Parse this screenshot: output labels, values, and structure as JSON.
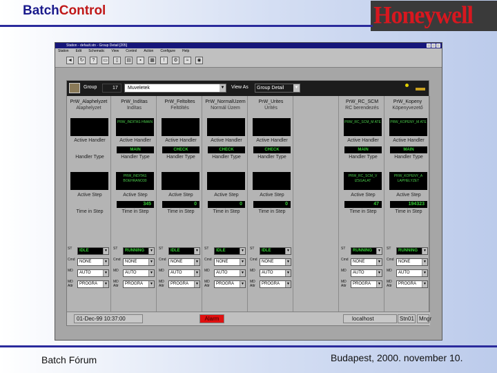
{
  "slide": {
    "title_part1": "Batch",
    "title_part2": "Control",
    "logo_text": "Honeywell",
    "footer_left": "Batch Fórum",
    "footer_right": "Budapest, 2000. november 10."
  },
  "window": {
    "titlebar": "Station - default.stn - Group Detail [205]",
    "menu": [
      "Station",
      "Edit",
      "Schematic",
      "View",
      "Control",
      "Action",
      "Configure",
      "Help"
    ]
  },
  "group_bar": {
    "group_label": "Group",
    "group_number": "17",
    "group_name": "Muveletek",
    "view_as_label": "View As",
    "view_as_value": "Group Detail"
  },
  "field_labels": {
    "active_handler": "Active Handler",
    "handler_type": "Handler Type",
    "active_step": "Active Step",
    "time_in_step": "Time in Step"
  },
  "columns": [
    {
      "tag": "PrW_Alaphelyzet",
      "desc": "Alaphelyzet",
      "handler_box": "",
      "handler_type": "",
      "step_box": "",
      "step": "",
      "state": "IDLE",
      "cmd": "NONE",
      "mode": "AUTO",
      "prog": "PROGRA"
    },
    {
      "tag": "PrW_Indítas",
      "desc": "Indítas",
      "handler_box": "PRW_INDITAS HMAIN",
      "handler_type": "MAIN",
      "step_box": "PRW_INDITAS BOEHRANO30",
      "step": "345",
      "state": "RUNNING",
      "cmd": "NONE",
      "mode": "AUTO",
      "prog": "PROGRA"
    },
    {
      "tag": "PrW_Feltoltes",
      "desc": "Feltöltés",
      "handler_box": "",
      "handler_type": "CHECK",
      "step_box": "",
      "step": "0",
      "state": "IDLE",
      "cmd": "NONE",
      "mode": "AUTO",
      "prog": "PROGRA"
    },
    {
      "tag": "PrW_NormalUzem",
      "desc": "Normál Üzem",
      "handler_box": "",
      "handler_type": "CHECK",
      "step_box": "",
      "step": "0",
      "state": "IDLE",
      "cmd": "NONE",
      "mode": "AUTO",
      "prog": "PROGRA"
    },
    {
      "tag": "PrW_Urites",
      "desc": "Ürítés",
      "handler_box": "",
      "handler_type": "CHECK",
      "step_box": "",
      "step": "0",
      "state": "IDLE",
      "cmd": "NONE",
      "mode": "AUTO",
      "prog": "PROGRA"
    },
    {
      "tag": "",
      "desc": "",
      "handler_box": "",
      "handler_type": "",
      "step_box": "",
      "step": "",
      "state": "",
      "cmd": "",
      "mode": "",
      "prog": ""
    },
    {
      "tag": "PrW_RC_SCM",
      "desc": "RC berendezés",
      "handler_box": "PRW_RC_SCM_M ATE",
      "handler_type": "MAIN",
      "step_box": "PRW_RC_SCM_V IZSGALAT",
      "step": "47",
      "state": "RUNNING",
      "cmd": "NONE",
      "mode": "AUTO",
      "prog": "PROGRA"
    },
    {
      "tag": "PrW_Kopeny",
      "desc": "Köpenyvezető",
      "handler_box": "PRW_KOPENY_M ATE",
      "handler_type": "MAIN",
      "step_box": "PRW_KOPENY_A LAPHELYZET",
      "step": "194323",
      "state": "RUNNING",
      "cmd": "NONE",
      "mode": "AUTO",
      "prog": "PROGRA"
    }
  ],
  "control_labels": {
    "state": "ST",
    "command": "Cmd",
    "mode": "MD",
    "prog_mode": "MD Attr"
  },
  "status_bar": {
    "datetime": "01-Dec-99 10:37:00",
    "alarm": "Alarm",
    "host": "localhost",
    "station": "Stn01",
    "user": "Mngr"
  },
  "colors": {
    "accent_line": "#2a2a9c",
    "status_green": "#35d035",
    "alarm_red": "#e01010"
  }
}
